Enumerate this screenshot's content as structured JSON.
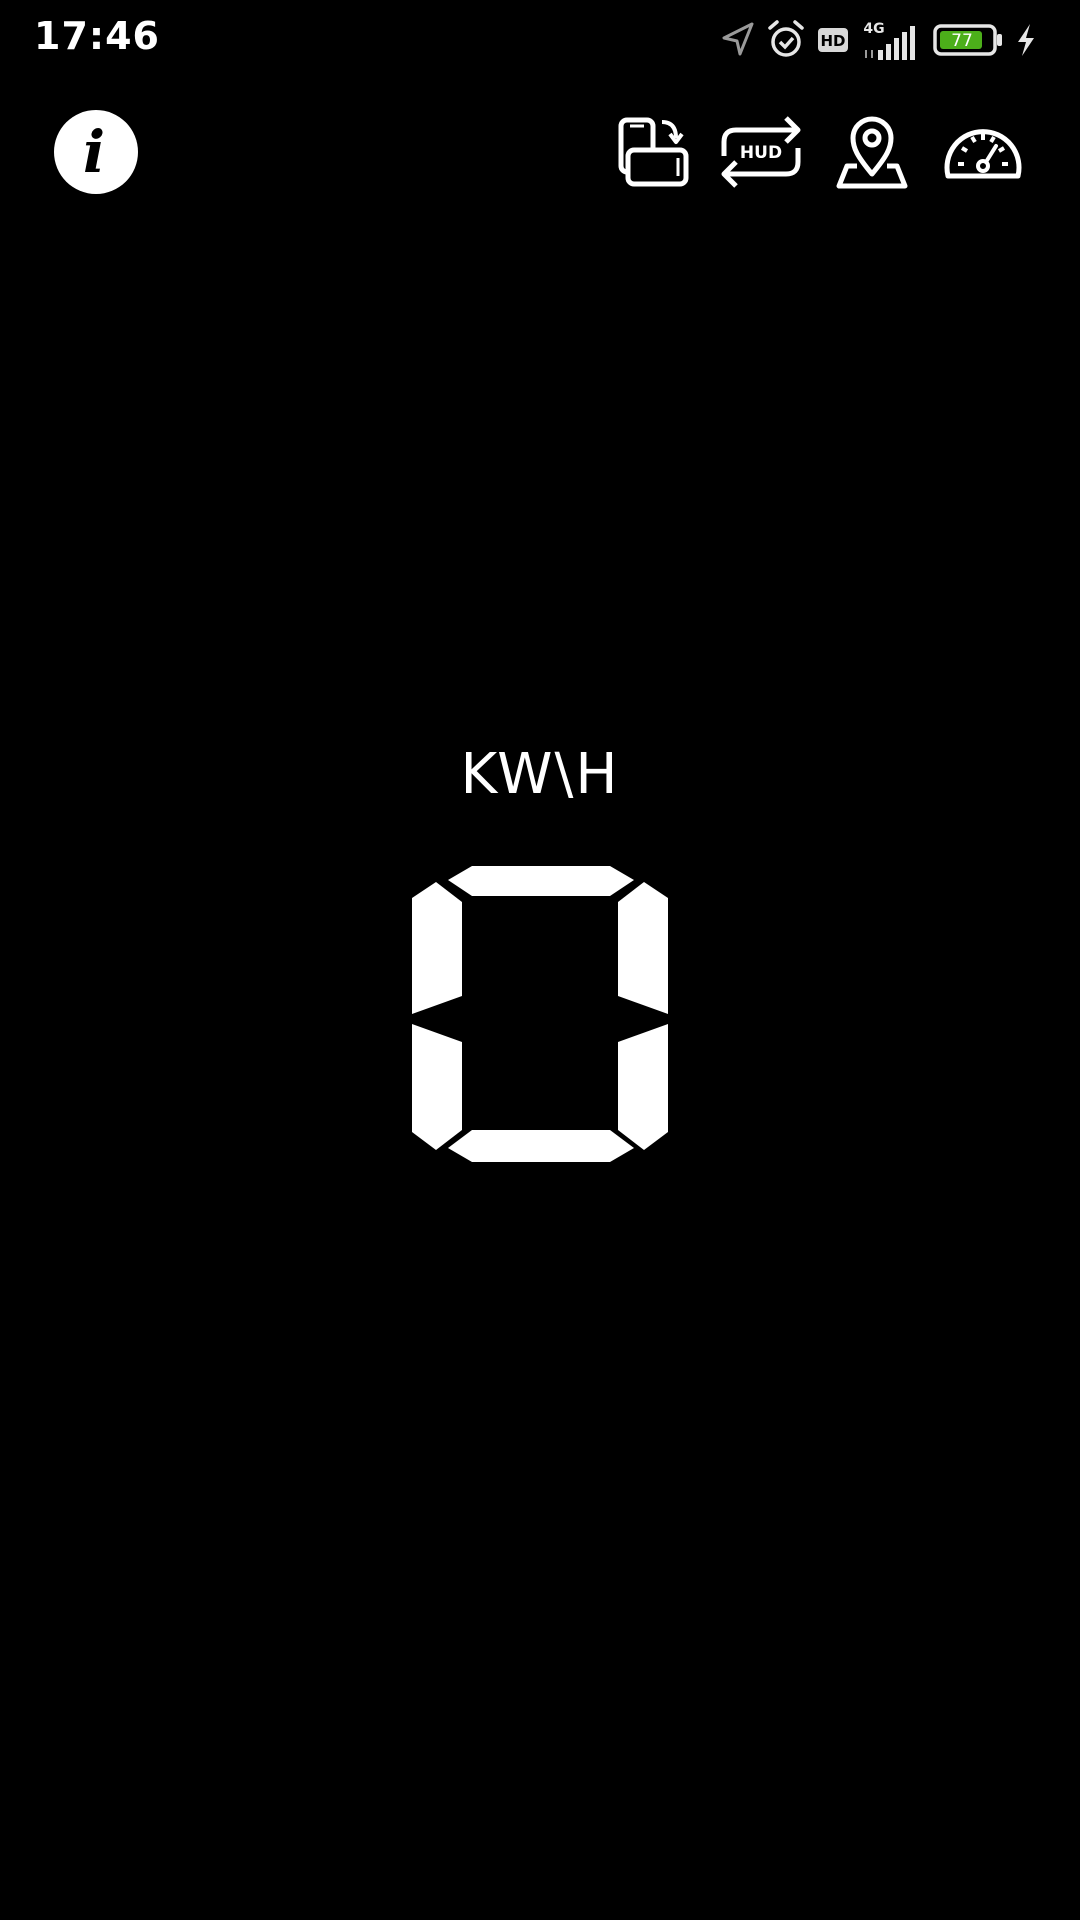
{
  "status_bar": {
    "time": "17:46",
    "network": "4G",
    "hd_badge": "HD",
    "battery_level": "77",
    "battery_color": "#4caf1a",
    "icons": [
      "location-arrow-icon",
      "alarm-icon",
      "hd-icon",
      "signal-icon",
      "battery-icon",
      "charging-bolt-icon"
    ]
  },
  "toolbar": {
    "info_icon": "info-icon",
    "rotate_icon": "screen-rotate-icon",
    "hud_label": "HUD",
    "map_icon": "map-pin-icon",
    "speedometer_icon": "speedometer-icon"
  },
  "display": {
    "unit": "KW\\H",
    "value": "0",
    "color": "#ffffff"
  }
}
